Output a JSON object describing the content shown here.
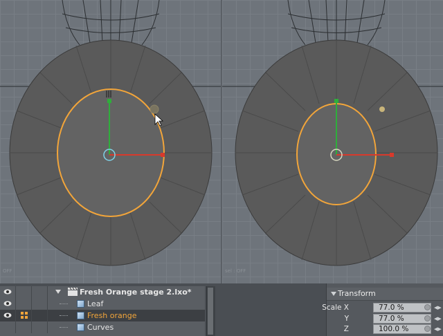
{
  "viewports": {
    "left_label": "OFF",
    "right_label": "sel : OFF"
  },
  "outliner": {
    "rows": [
      {
        "label": "Fresh Orange stage 2.lxo*",
        "type": "scene"
      },
      {
        "label": "Leaf",
        "type": "mesh"
      },
      {
        "label": "Fresh orange",
        "type": "mesh",
        "selected": true
      },
      {
        "label": "Curves",
        "type": "mesh"
      }
    ]
  },
  "properties": {
    "section_title": "Transform",
    "fields": [
      {
        "label": "Scale X",
        "value": "77.0 %"
      },
      {
        "label": "Y",
        "value": "77.0 %"
      },
      {
        "label": "Z",
        "value": "100.0 %"
      }
    ]
  },
  "colors": {
    "accent_orange": "#f2a53a",
    "axis_x": "#d8392b",
    "axis_y": "#2fae3b",
    "mesh_fill": "#5a5a5a"
  },
  "icons": [
    "eye-icon",
    "scene-clapper-icon",
    "mesh-cube-icon",
    "lock-overlay-icon",
    "mouse-cursor-icon"
  ]
}
